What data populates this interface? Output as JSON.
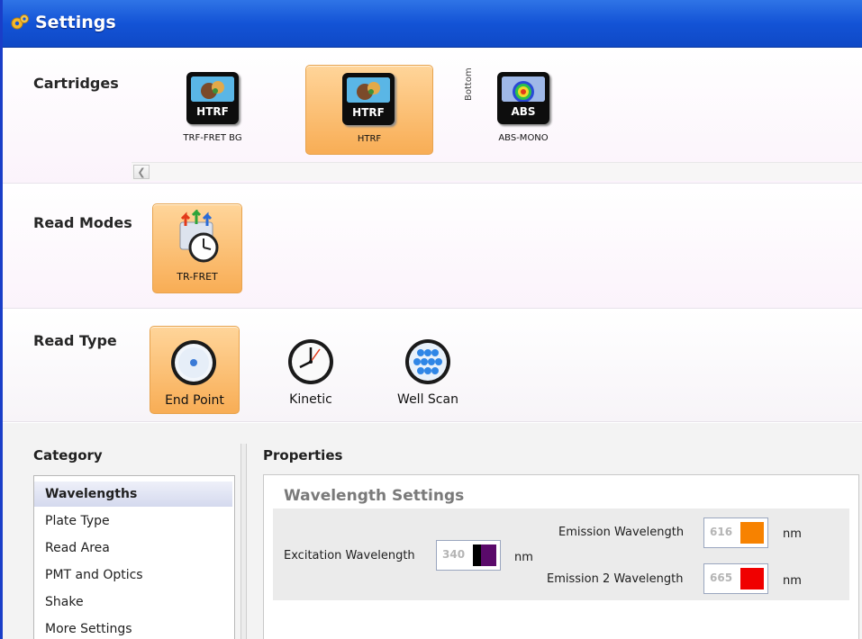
{
  "window": {
    "title": "Settings",
    "title_icon": "gear-icon"
  },
  "cartridges": {
    "label": "Cartridges",
    "items": [
      {
        "icon_text": "HTRF",
        "caption": "TRF-FRET BG",
        "selected": false
      },
      {
        "icon_text": "HTRF",
        "caption": "HTRF",
        "selected": true
      },
      {
        "icon_text": "ABS",
        "caption": "ABS-MONO",
        "selected": false,
        "position_label": "Bottom"
      }
    ]
  },
  "read_modes": {
    "label": "Read Modes",
    "items": [
      {
        "caption": "TR-FRET",
        "selected": true
      }
    ]
  },
  "read_type": {
    "label": "Read Type",
    "items": [
      {
        "caption": "End Point",
        "selected": true
      },
      {
        "caption": "Kinetic",
        "selected": false
      },
      {
        "caption": "Well Scan",
        "selected": false
      }
    ]
  },
  "category": {
    "label": "Category",
    "items": [
      "Wavelengths",
      "Plate Type",
      "Read Area",
      "PMT and Optics",
      "Shake",
      "More Settings"
    ],
    "selected_index": 0
  },
  "properties": {
    "label": "Properties",
    "section_title": "Wavelength Settings",
    "excitation": {
      "label": "Excitation Wavelength",
      "value": "340",
      "unit": "nm",
      "color": "#5a0a6a"
    },
    "emission": {
      "label": "Emission Wavelength",
      "value": "616",
      "unit": "nm",
      "color": "#f78200"
    },
    "emission2": {
      "label": "Emission 2 Wavelength",
      "value": "665",
      "unit": "nm",
      "color": "#f00000"
    }
  },
  "colors": {
    "title_bar": "#1353d6",
    "selected_tile": "#f8ad55"
  }
}
